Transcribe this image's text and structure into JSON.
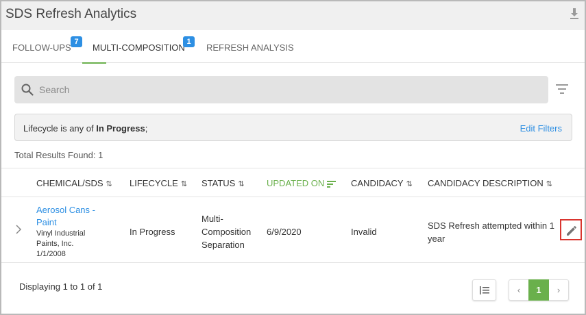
{
  "app": {
    "title": "SDS Refresh Analytics"
  },
  "tabs": [
    {
      "label": "FOLLOW-UPS",
      "badge": "7"
    },
    {
      "label": "MULTI-COMPOSITION",
      "badge": "1"
    },
    {
      "label": "REFRESH ANALYSIS"
    }
  ],
  "search": {
    "placeholder": "Search",
    "value": ""
  },
  "filters": {
    "prefix": "Lifecycle is any of ",
    "value": "In Progress",
    "suffix": ";",
    "edit_label": "Edit Filters"
  },
  "results": {
    "total_text": "Total Results Found: 1"
  },
  "table": {
    "headers": [
      {
        "label": "CHEMICAL/SDS"
      },
      {
        "label": "LIFECYCLE"
      },
      {
        "label": "STATUS"
      },
      {
        "label": "UPDATED ON"
      },
      {
        "label": "CANDIDACY"
      },
      {
        "label": "CANDIDACY DESCRIPTION"
      }
    ],
    "rows": [
      {
        "chemical": "Aerosol Cans - Paint",
        "manufacturer": "Vinyl Industrial Paints, Inc.",
        "sds_date": "1/1/2008",
        "lifecycle": "In Progress",
        "status": "Multi-Composition Separation",
        "updated_on": "6/9/2020",
        "candidacy": "Invalid",
        "candidacy_description": "SDS Refresh attempted within 1 year"
      }
    ]
  },
  "footer": {
    "displaying": "Displaying 1 to 1 of 1",
    "current_page": "1",
    "prev": "‹",
    "next": "›"
  },
  "colors": {
    "accent_green": "#6ab04c",
    "link_blue": "#2d8fe3",
    "highlight_red": "#d9352f"
  }
}
